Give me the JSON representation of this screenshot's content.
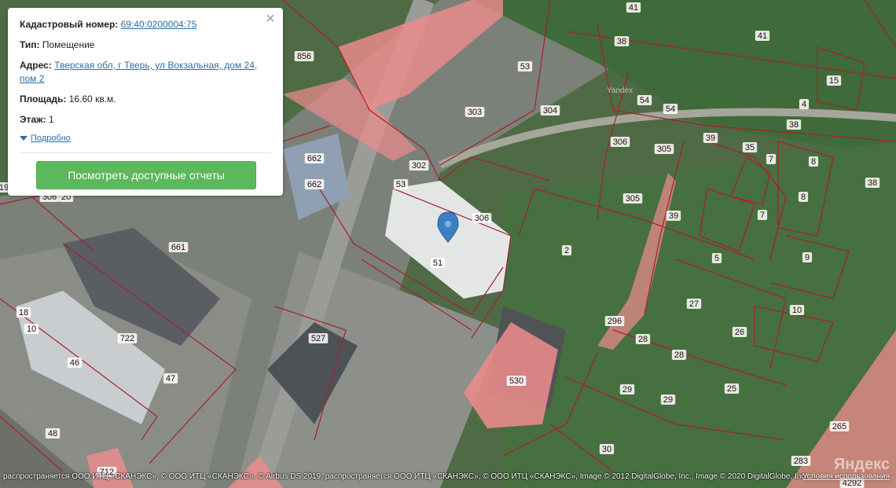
{
  "popup": {
    "cadastral_label": "Кадастровый номер:",
    "cadastral_value": "69:40:0200004:75",
    "type_label": "Тип:",
    "type_value": "Помещение",
    "address_label": "Адрес:",
    "address_value": "Тверская обл, г Тверь, ул Вокзальная, дом 24, пом 2",
    "area_label": "Площадь:",
    "area_value": "16.60 кв.м.",
    "floor_label": "Этаж:",
    "floor_value": "1",
    "more_label": "Подробно",
    "reports_button": "Посмотреть доступные отчеты",
    "close_icon": "close-icon"
  },
  "map": {
    "parcel_labels": [
      "41",
      "41",
      "38",
      "856",
      "53",
      "303",
      "304",
      "54",
      "54",
      "15",
      "4",
      "38",
      "306",
      "305",
      "39",
      "35",
      "7",
      "8",
      "38",
      "662",
      "662",
      "302",
      "53",
      "306",
      "305",
      "8",
      "39",
      "7",
      "9",
      "661",
      "51",
      "2",
      "5",
      "27",
      "10",
      "18",
      "722",
      "296",
      "26",
      "28",
      "28",
      "527",
      "46",
      "47",
      "530",
      "25",
      "29",
      "29",
      "265",
      "48",
      "30",
      "283",
      "4292",
      "20",
      "306",
      "19",
      "712",
      "10"
    ],
    "pin_icon": "map-pin-icon",
    "watermark_small": "Yandex",
    "logo_text": "Яндекс",
    "copyright": "распространяется ООО ИТЦ «СКАНЭКС», © ООО ИТЦ «СКАНЭКС», © Airbus DS 2019, распространяется ООО ИТЦ «СКАНЭКС», © ООО ИТЦ «СКАНЭКС», Image © 2012 DigitalGlobe, Inc., Image © 2020 DigitalGlobe, Inc.",
    "terms": "Условия использования",
    "colors": {
      "parcel_fill": "#f08c8c",
      "parcel_stroke": "#a8202a",
      "button": "#5cb85c",
      "link": "#2c6ea6",
      "pin": "#3a7fc4"
    }
  }
}
